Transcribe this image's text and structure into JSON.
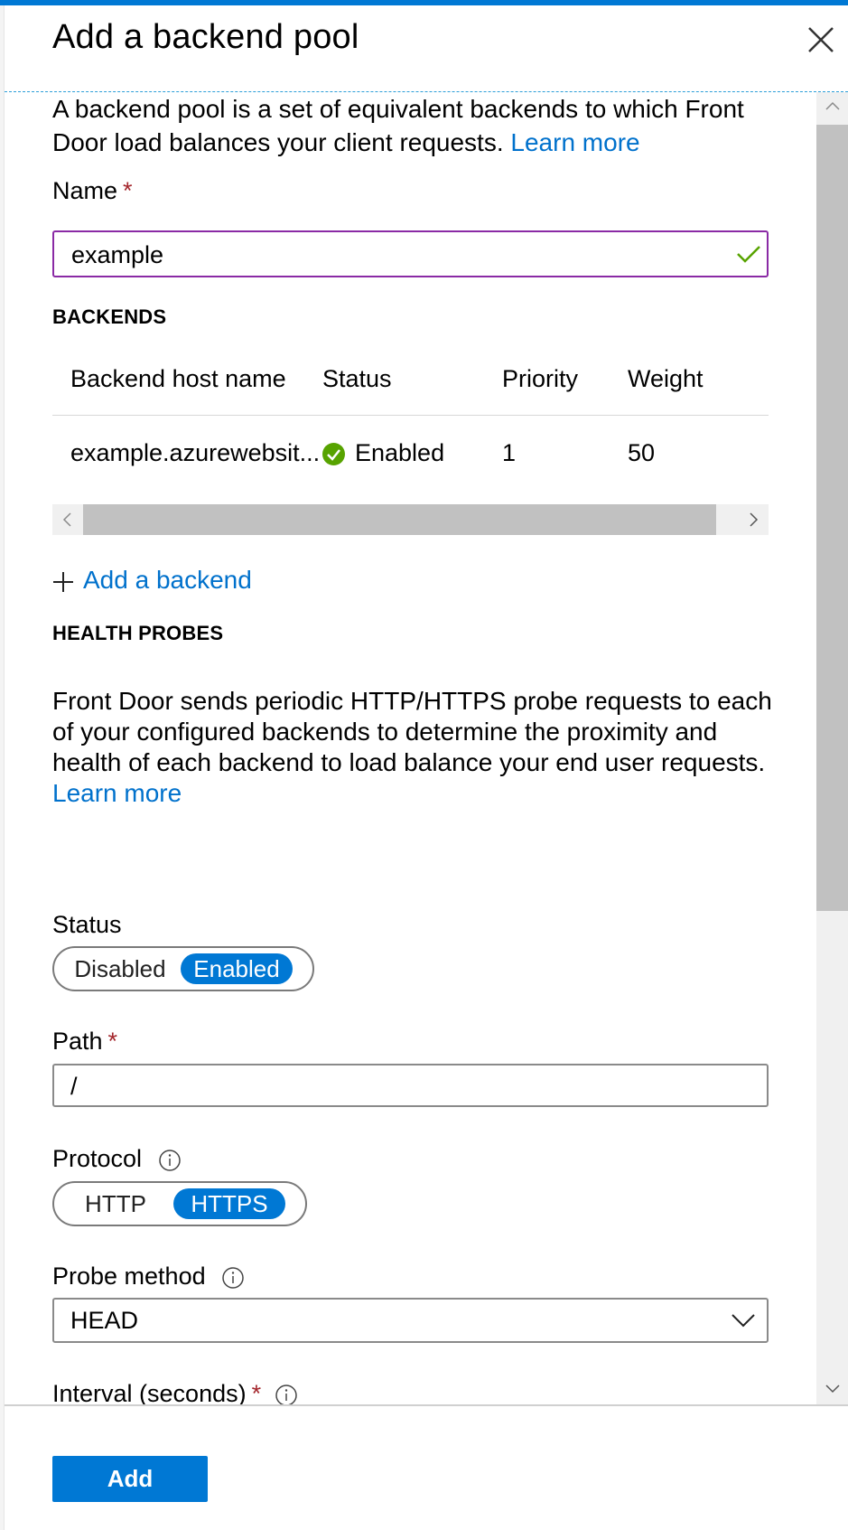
{
  "blade": {
    "title": "Add a backend pool",
    "intro_text": "A backend pool is a set of equivalent backends to which Front Door load balances your client requests.",
    "intro_link": "Learn more"
  },
  "name_field": {
    "label": "Name",
    "required_mark": "*",
    "value": "example"
  },
  "backends": {
    "heading": "BACKENDS",
    "columns": [
      "Backend host name",
      "Status",
      "Priority",
      "Weight"
    ],
    "rows": [
      {
        "host": "example.azurewebsit...",
        "status": "Enabled",
        "priority": "1",
        "weight": "50"
      }
    ],
    "add_label": "Add a backend"
  },
  "health_probes": {
    "heading": "HEALTH PROBES",
    "description": "Front Door sends periodic HTTP/HTTPS probe requests to each of your configured backends to determine the proximity and health of each backend to load balance your end user requests.",
    "link": "Learn more",
    "status": {
      "label": "Status",
      "options": [
        "Disabled",
        "Enabled"
      ],
      "selected": "Enabled"
    },
    "path": {
      "label": "Path",
      "required_mark": "*",
      "value": "/"
    },
    "protocol": {
      "label": "Protocol",
      "options": [
        "HTTP",
        "HTTPS"
      ],
      "selected": "HTTPS"
    },
    "probe_method": {
      "label": "Probe method",
      "value": "HEAD"
    },
    "interval": {
      "label": "Interval (seconds)",
      "required_mark": "*"
    }
  },
  "footer": {
    "add_button": "Add"
  },
  "colors": {
    "accent": "#0078d4",
    "link": "#0071cc",
    "valid_check": "#57a300",
    "focus_border": "#8a2aa5",
    "required": "#a4262c"
  },
  "icons": [
    "close-icon",
    "checkmark-icon",
    "status-enabled-icon",
    "plus-icon",
    "info-icon",
    "chevron-down-icon",
    "scroll-up-arrow-icon",
    "scroll-down-arrow-icon",
    "scroll-left-arrow-icon",
    "scroll-right-arrow-icon"
  ]
}
